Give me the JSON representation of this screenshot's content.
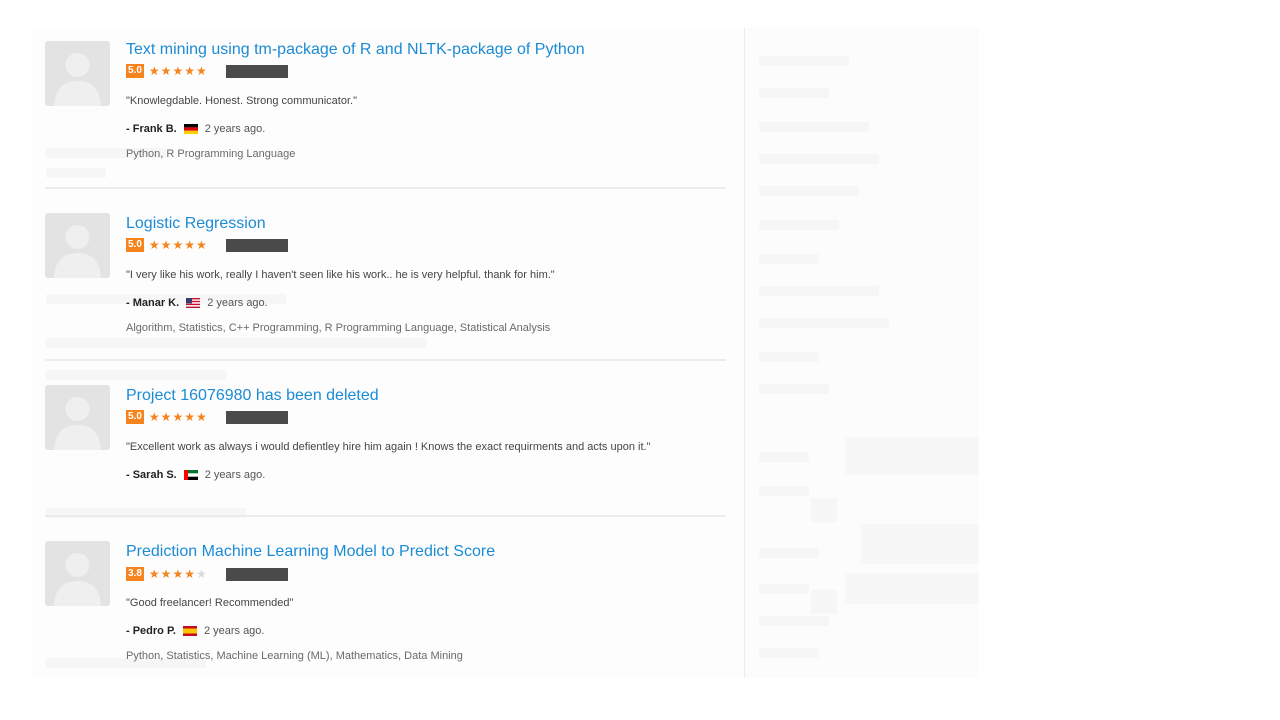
{
  "reviews": [
    {
      "title": "Text mining using tm-package of R and NLTK-package of Python",
      "score": "5.0",
      "stars": 5,
      "quote": "\"Knowlegdable. Honest. Strong communicator.\"",
      "author": "- Frank B.",
      "flag": "germany-flag",
      "time": "2 years ago.",
      "skills": "Python, R Programming Language"
    },
    {
      "title": "Logistic Regression",
      "score": "5.0",
      "stars": 5,
      "quote": "\"I very like his work, really I haven't seen like his work.. he is very helpful. thank for him.\"",
      "author": "- Manar K.",
      "flag": "usa-flag",
      "time": "2 years ago.",
      "skills": "Algorithm, Statistics, C++ Programming, R Programming Language, Statistical Analysis"
    },
    {
      "title": "Project 16076980 has been deleted",
      "score": "5.0",
      "stars": 5,
      "quote": "\"Excellent work as always i would defientley hire him again ! Knows the exact requirments and acts upon it.\"",
      "author": "- Sarah S.",
      "flag": "uae-flag",
      "time": "2 years ago.",
      "skills": ""
    },
    {
      "title": "Prediction Machine Learning Model to Predict Score",
      "score": "3.8",
      "stars": 4,
      "quote": "\"Good freelancer! Recommended\"",
      "author": "- Pedro P.",
      "flag": "spain-flag",
      "time": "2 years ago.",
      "skills": "Python, Statistics, Machine Learning (ML), Mathematics, Data Mining"
    }
  ],
  "colors": {
    "link": "#1b8bd6",
    "rating": "#f5841f",
    "redaction": "#4b4b4b"
  }
}
